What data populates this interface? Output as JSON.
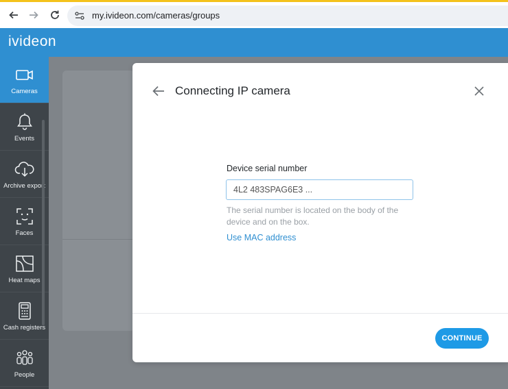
{
  "browser": {
    "back_icon": "arrow-left-icon",
    "forward_icon": "arrow-right-icon",
    "reload_icon": "reload-icon",
    "url": "my.ivideon.com/cameras/groups"
  },
  "header": {
    "logo": "ivideon"
  },
  "sidebar": {
    "items": [
      {
        "label": "Cameras",
        "icon": "camera-icon",
        "active": true
      },
      {
        "label": "Events",
        "icon": "bell-icon"
      },
      {
        "label": "Archive export",
        "icon": "cloud-download-icon"
      },
      {
        "label": "Faces",
        "icon": "face-scan-icon"
      },
      {
        "label": "Heat maps",
        "icon": "heat-map-icon"
      },
      {
        "label": "Cash registers",
        "icon": "cash-register-icon"
      },
      {
        "label": "People",
        "icon": "people-icon"
      }
    ]
  },
  "dialog": {
    "title": "Connecting IP camera",
    "field_label": "Device serial number",
    "serial_value": "4L2 483SPAG6E3 ...",
    "hint": "The serial number is located on the body of the device and on the box.",
    "mac_link": "Use MAC address",
    "continue": "CONTINUE"
  },
  "colors": {
    "accent": "#2f8fd1",
    "button": "#1e9ae6",
    "sidebar": "#3e4449"
  }
}
